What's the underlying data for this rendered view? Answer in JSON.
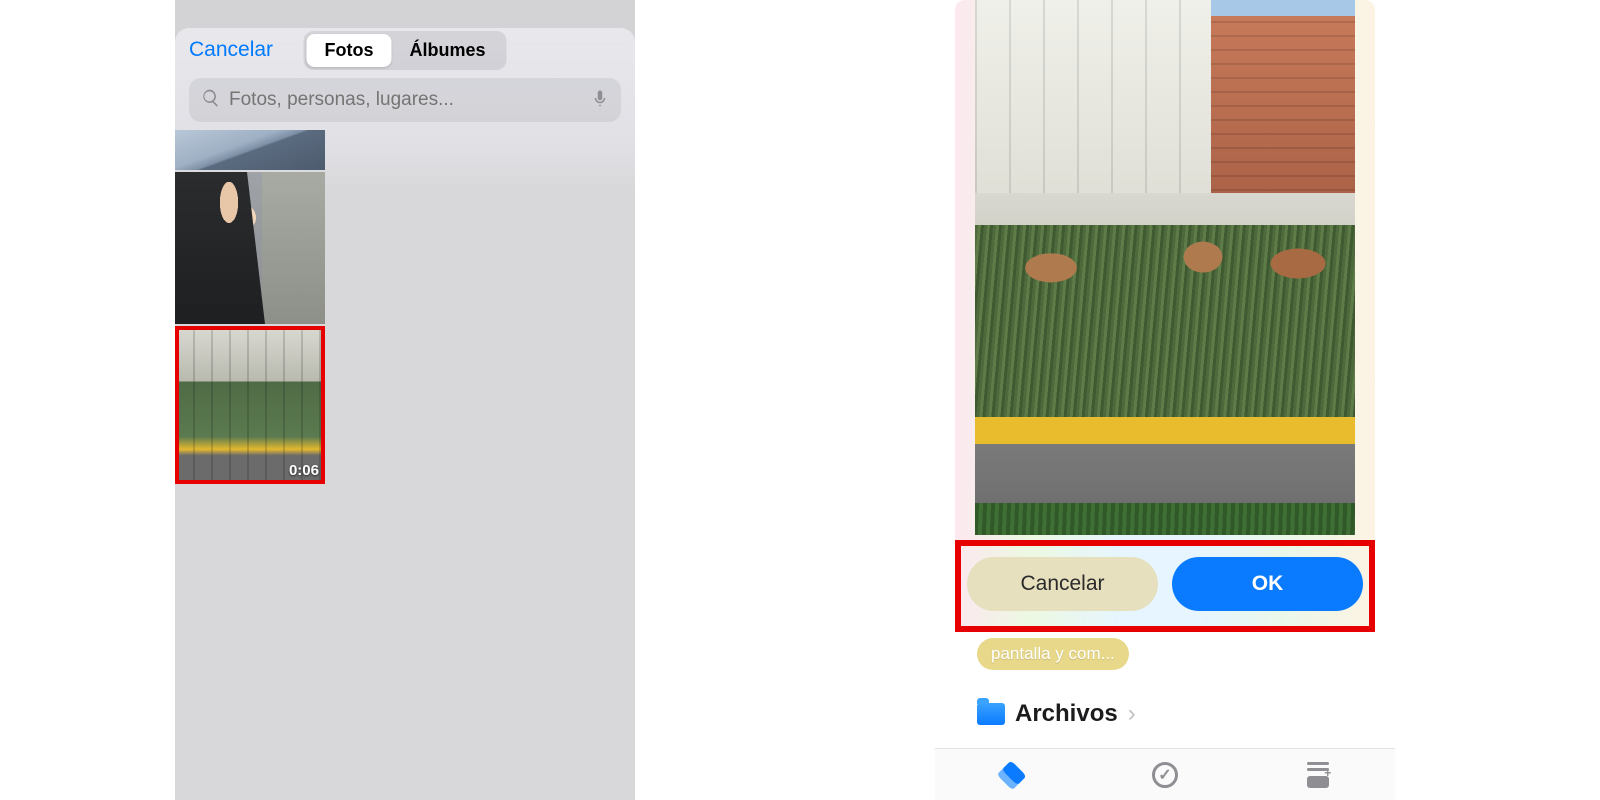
{
  "left": {
    "cancel": "Cancelar",
    "tabs": {
      "photos": "Fotos",
      "albums": "Álbumes"
    },
    "search_placeholder": "Fotos, personas, lugares...",
    "video_duration": "0:06"
  },
  "right": {
    "cancel_btn": "Cancelar",
    "ok_btn": "OK",
    "chip_text": "pantalla y com...",
    "files_label": "Archivos"
  }
}
